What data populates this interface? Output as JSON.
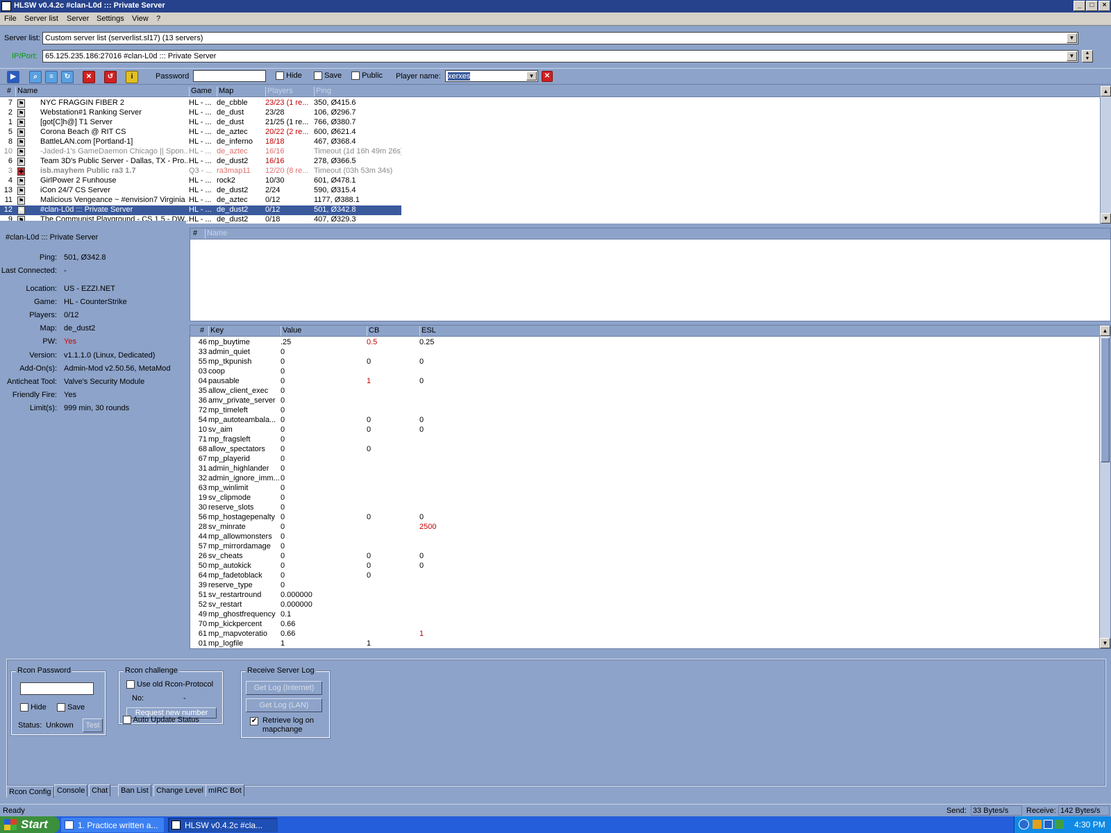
{
  "window": {
    "title": "HLSW v0.4.2c   #clan-L0d ::: Private Server",
    "controls": [
      "_",
      "□",
      "×"
    ]
  },
  "menu": [
    "File",
    "Server list",
    "Server",
    "Settings",
    "View",
    "?"
  ],
  "serverlist": {
    "label": "Server list:",
    "value": "Custom server list (serverlist.sl17) (13 servers)"
  },
  "ipport": {
    "label": "IP/Port:",
    "value": "65.125.235.186:27016 #clan-L0d ::: Private Server"
  },
  "toolbar": {
    "password_label": "Password",
    "password_value": "",
    "hide_label": "Hide",
    "save_label": "Save",
    "public_label": "Public",
    "player_name_label": "Player name:",
    "player_name_value": "xerxes"
  },
  "servers": {
    "headers": [
      "#",
      "Name",
      "Game",
      "Map",
      "Players",
      "Ping"
    ],
    "rows": [
      {
        "num": "7",
        "name": "NYC FRAGGIN FIBER 2",
        "game": "HL - ...",
        "map": "de_cbble",
        "players": "23/23 (1 re...",
        "ping": "350, Ø415.6",
        "style": "full"
      },
      {
        "num": "2",
        "name": "Webstation#1 Ranking Server",
        "game": "HL - ...",
        "map": "de_dust",
        "players": "23/28",
        "ping": "106, Ø296.7",
        "style": ""
      },
      {
        "num": "1",
        "name": "[got[C]h@] T1 Server",
        "game": "HL - ...",
        "map": "de_dust",
        "players": "21/25 (1 re...",
        "ping": "766, Ø380.7",
        "style": ""
      },
      {
        "num": "5",
        "name": "Corona Beach @ RIT CS",
        "game": "HL - ...",
        "map": "de_aztec",
        "players": "20/22 (2 re...",
        "ping": "600, Ø621.4",
        "style": "full"
      },
      {
        "num": "8",
        "name": "BattleLAN.com [Portland-1]",
        "game": "HL - ...",
        "map": "de_inferno",
        "players": "18/18",
        "ping": "467, Ø368.4",
        "style": "full"
      },
      {
        "num": "10",
        "name": "-Jaded-1's GameDaemon Chicago || Spon...",
        "game": "HL - ...",
        "map": "de_aztec",
        "players": "16/16",
        "ping": "Timeout (1d 16h 49m 26s)",
        "style": "timeout"
      },
      {
        "num": "6",
        "name": "Team 3D's Public Server - Dallas, TX - Pro...",
        "game": "HL - ...",
        "map": "de_dust2",
        "players": "16/16",
        "ping": "278, Ø366.5",
        "style": "full"
      },
      {
        "num": "3",
        "name": "isb.mayhem Public ra3 1.7",
        "game": "Q3 - ...",
        "map": "ra3map11",
        "players": "12/20 (8 re...",
        "ping": "Timeout (03h 53m 34s)",
        "style": "timeout-bold"
      },
      {
        "num": "4",
        "name": "GirlPower 2 Funhouse",
        "game": "HL - ...",
        "map": "rock2",
        "players": "10/30",
        "ping": "601, Ø478.1",
        "style": ""
      },
      {
        "num": "13",
        "name": "iCon 24/7 CS Server",
        "game": "HL - ...",
        "map": "de_dust2",
        "players": "2/24",
        "ping": "590, Ø315.4",
        "style": ""
      },
      {
        "num": "11",
        "name": "Malicious Vengeance ~ #envision7 Virginia",
        "game": "HL - ...",
        "map": "de_aztec",
        "players": "0/12",
        "ping": "1177, Ø388.1",
        "style": ""
      },
      {
        "num": "12",
        "name": "#clan-L0d ::: Private Server",
        "game": "HL - ...",
        "map": "de_dust2",
        "players": "0/12",
        "ping": "501, Ø342.8",
        "style": "selected"
      },
      {
        "num": "9",
        "name": "The Communist Playground - CS 1.5 - DW...",
        "game": "HL - ...",
        "map": "de_dust2",
        "players": "0/18",
        "ping": "407, Ø329.3",
        "style": ""
      }
    ]
  },
  "info": {
    "server_name": "#clan-L0d ::: Private Server",
    "rows": [
      {
        "k": "Ping:",
        "v": "501, Ø342.8"
      },
      {
        "k": "Last Connected:",
        "v": "-"
      },
      {
        "k": "Location:",
        "v": "US - EZZI.NET"
      },
      {
        "k": "Game:",
        "v": "HL - CounterStrike"
      },
      {
        "k": "Players:",
        "v": "0/12"
      },
      {
        "k": "Map:",
        "v": "de_dust2"
      },
      {
        "k": "PW:",
        "v": "Yes"
      },
      {
        "k": "Version:",
        "v": "v1.1.1.0 (Linux, Dedicated)"
      },
      {
        "k": "Add-On(s):",
        "v": "Admin-Mod v2.50.56, MetaMod"
      },
      {
        "k": "Anticheat Tool:",
        "v": "Valve's Security Module"
      },
      {
        "k": "Friendly Fire:",
        "v": "Yes"
      },
      {
        "k": "Limit(s):",
        "v": "999 min, 30 rounds"
      }
    ]
  },
  "players": {
    "headers": [
      "#",
      "Name"
    ]
  },
  "rules": {
    "headers": [
      "#",
      "Key",
      "Value",
      "CB",
      "ESL"
    ],
    "rows": [
      {
        "n": "46",
        "k": "mp_buytime",
        "v": ".25",
        "cb": "0.5",
        "esl": "0.25",
        "cbr": true,
        "eslr": false
      },
      {
        "n": "33",
        "k": "admin_quiet",
        "v": "0",
        "cb": "",
        "esl": "",
        "cbr": false,
        "eslr": false
      },
      {
        "n": "55",
        "k": "mp_tkpunish",
        "v": "0",
        "cb": "0",
        "esl": "0",
        "cbr": false,
        "eslr": false
      },
      {
        "n": "03",
        "k": "coop",
        "v": "0",
        "cb": "",
        "esl": "",
        "cbr": false,
        "eslr": false
      },
      {
        "n": "04",
        "k": "pausable",
        "v": "0",
        "cb": "1",
        "esl": "0",
        "cbr": true,
        "eslr": false
      },
      {
        "n": "35",
        "k": "allow_client_exec",
        "v": "0",
        "cb": "",
        "esl": "",
        "cbr": false,
        "eslr": false
      },
      {
        "n": "36",
        "k": "amv_private_server",
        "v": "0",
        "cb": "",
        "esl": "",
        "cbr": false,
        "eslr": false
      },
      {
        "n": "72",
        "k": "mp_timeleft",
        "v": "0",
        "cb": "",
        "esl": "",
        "cbr": false,
        "eslr": false
      },
      {
        "n": "54",
        "k": "mp_autoteambala...",
        "v": "0",
        "cb": "0",
        "esl": "0",
        "cbr": false,
        "eslr": false
      },
      {
        "n": "10",
        "k": "sv_aim",
        "v": "0",
        "cb": "0",
        "esl": "0",
        "cbr": false,
        "eslr": false
      },
      {
        "n": "71",
        "k": "mp_fragsleft",
        "v": "0",
        "cb": "",
        "esl": "",
        "cbr": false,
        "eslr": false
      },
      {
        "n": "68",
        "k": "allow_spectators",
        "v": "0",
        "cb": "0",
        "esl": "",
        "cbr": false,
        "eslr": false
      },
      {
        "n": "67",
        "k": "mp_playerid",
        "v": "0",
        "cb": "",
        "esl": "",
        "cbr": false,
        "eslr": false
      },
      {
        "n": "31",
        "k": "admin_highlander",
        "v": "0",
        "cb": "",
        "esl": "",
        "cbr": false,
        "eslr": false
      },
      {
        "n": "32",
        "k": "admin_ignore_imm...",
        "v": "0",
        "cb": "",
        "esl": "",
        "cbr": false,
        "eslr": false
      },
      {
        "n": "63",
        "k": "mp_winlimit",
        "v": "0",
        "cb": "",
        "esl": "",
        "cbr": false,
        "eslr": false
      },
      {
        "n": "19",
        "k": "sv_clipmode",
        "v": "0",
        "cb": "",
        "esl": "",
        "cbr": false,
        "eslr": false
      },
      {
        "n": "30",
        "k": "reserve_slots",
        "v": "0",
        "cb": "",
        "esl": "",
        "cbr": false,
        "eslr": false
      },
      {
        "n": "56",
        "k": "mp_hostagepenalty",
        "v": "0",
        "cb": "0",
        "esl": "0",
        "cbr": false,
        "eslr": false
      },
      {
        "n": "28",
        "k": "sv_minrate",
        "v": "0",
        "cb": "",
        "esl": "2500",
        "cbr": false,
        "eslr": true
      },
      {
        "n": "44",
        "k": "mp_allowmonsters",
        "v": "0",
        "cb": "",
        "esl": "",
        "cbr": false,
        "eslr": false
      },
      {
        "n": "57",
        "k": "mp_mirrordamage",
        "v": "0",
        "cb": "",
        "esl": "",
        "cbr": false,
        "eslr": false
      },
      {
        "n": "26",
        "k": "sv_cheats",
        "v": "0",
        "cb": "0",
        "esl": "0",
        "cbr": false,
        "eslr": false
      },
      {
        "n": "50",
        "k": "mp_autokick",
        "v": "0",
        "cb": "0",
        "esl": "0",
        "cbr": false,
        "eslr": false
      },
      {
        "n": "64",
        "k": "mp_fadetoblack",
        "v": "0",
        "cb": "0",
        "esl": "",
        "cbr": false,
        "eslr": false
      },
      {
        "n": "39",
        "k": "reserve_type",
        "v": "0",
        "cb": "",
        "esl": "",
        "cbr": false,
        "eslr": false
      },
      {
        "n": "51",
        "k": "sv_restartround",
        "v": "0.000000",
        "cb": "",
        "esl": "",
        "cbr": false,
        "eslr": false
      },
      {
        "n": "52",
        "k": "sv_restart",
        "v": "0.000000",
        "cb": "",
        "esl": "",
        "cbr": false,
        "eslr": false
      },
      {
        "n": "49",
        "k": "mp_ghostfrequency",
        "v": "0.1",
        "cb": "",
        "esl": "",
        "cbr": false,
        "eslr": false
      },
      {
        "n": "70",
        "k": "mp_kickpercent",
        "v": "0.66",
        "cb": "",
        "esl": "",
        "cbr": false,
        "eslr": false
      },
      {
        "n": "61",
        "k": "mp_mapvoteratio",
        "v": "0.66",
        "cb": "",
        "esl": "1",
        "cbr": false,
        "eslr": true
      },
      {
        "n": "01",
        "k": "mp_logfile",
        "v": "1",
        "cb": "1",
        "esl": "",
        "cbr": false,
        "eslr": false
      }
    ]
  },
  "rcon": {
    "password_group": "Rcon Password",
    "password_value": "",
    "hide_label": "Hide",
    "save_label": "Save",
    "status_label": "Status:",
    "status_value": "Unkown",
    "test_label": "Test",
    "challenge_group": "Rcon challenge",
    "old_protocol_label": "Use old Rcon-Protocol",
    "no_label": "No:",
    "no_value": "-",
    "request_label": "Request new number",
    "auto_update_label": "Auto Update Status",
    "log_group": "Receive Server Log",
    "log_internet": "Get Log (Internet)",
    "log_lan": "Get Log (LAN)",
    "retrieve_label": "Retrieve log on mapchange"
  },
  "tabs": [
    "Rcon Config",
    "Console",
    "Chat",
    "Ban List",
    "Change Level",
    "mIRC Bot"
  ],
  "status": {
    "text": "Ready",
    "send_label": "Send:",
    "send_value": "33 Bytes/s",
    "receive_label": "Receive:",
    "receive_value": "142 Bytes/s"
  },
  "taskbar": {
    "start": "Start",
    "items": [
      "1. Practice written a...",
      "HLSW v0.4.2c  #cla..."
    ],
    "clock": "4:30 PM"
  },
  "colors": {
    "accent": "#26428c",
    "selection": "#3a5a9c",
    "full": "#c00000",
    "timeout": "#8a8a8a"
  }
}
